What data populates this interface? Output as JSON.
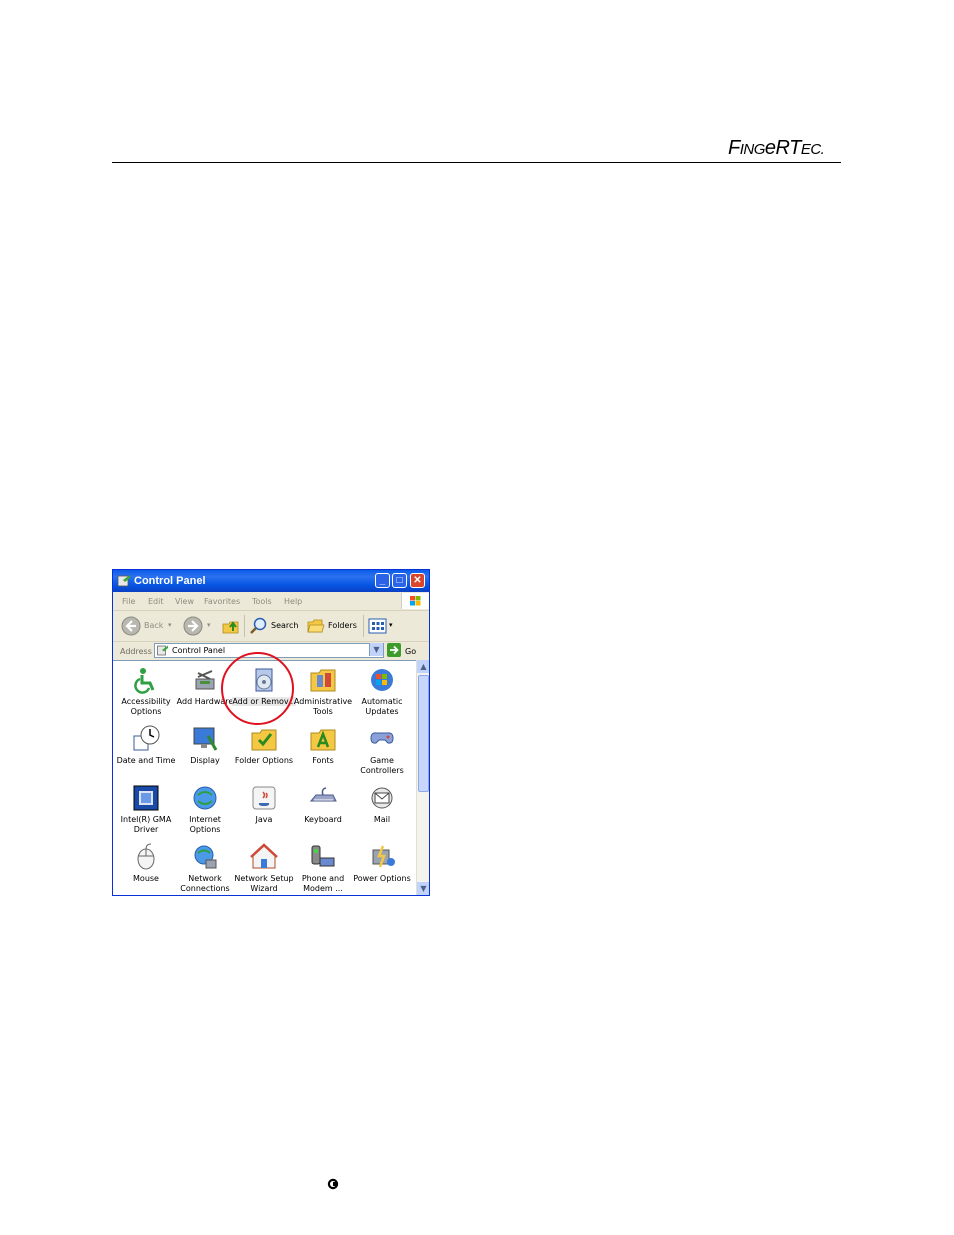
{
  "header": {
    "logo": {
      "part1": "F",
      "part2": "ING",
      "part3": "e",
      "part4": "R",
      "part5": "T",
      "part6": "EC",
      "dot": "."
    }
  },
  "window": {
    "title": "Control Panel",
    "menu": [
      "File",
      "Edit",
      "View",
      "Favorites",
      "Tools",
      "Help"
    ],
    "toolbar": {
      "back": "Back",
      "search": "Search",
      "folders": "Folders"
    },
    "address": {
      "label": "Address",
      "value": "Control Panel",
      "go": "Go"
    },
    "items": [
      {
        "label": "Accessibility Options",
        "icon": "accessibility-icon"
      },
      {
        "label": "Add Hardware",
        "icon": "add-hardware-icon"
      },
      {
        "label": "Add or Remov...",
        "icon": "add-remove-programs-icon"
      },
      {
        "label": "Administrative Tools",
        "icon": "administrative-tools-icon"
      },
      {
        "label": "Automatic Updates",
        "icon": "automatic-updates-icon"
      },
      {
        "label": "Date and Time",
        "icon": "date-time-icon"
      },
      {
        "label": "Display",
        "icon": "display-icon"
      },
      {
        "label": "Folder Options",
        "icon": "folder-options-icon"
      },
      {
        "label": "Fonts",
        "icon": "fonts-icon"
      },
      {
        "label": "Game Controllers",
        "icon": "game-controllers-icon"
      },
      {
        "label": "Intel(R) GMA Driver",
        "icon": "intel-gma-icon"
      },
      {
        "label": "Internet Options",
        "icon": "internet-options-icon"
      },
      {
        "label": "Java",
        "icon": "java-icon"
      },
      {
        "label": "Keyboard",
        "icon": "keyboard-icon"
      },
      {
        "label": "Mail",
        "icon": "mail-icon"
      },
      {
        "label": "Mouse",
        "icon": "mouse-icon"
      },
      {
        "label": "Network Connections",
        "icon": "network-connections-icon"
      },
      {
        "label": "Network Setup Wizard",
        "icon": "network-setup-icon"
      },
      {
        "label": "Phone and Modem ...",
        "icon": "phone-modem-icon"
      },
      {
        "label": "Power Options",
        "icon": "power-options-icon"
      }
    ],
    "highlighted_item": "Add or Remov..."
  },
  "colors": {
    "titlebar": "#0a5ce6",
    "highlight": "#e0101e"
  }
}
